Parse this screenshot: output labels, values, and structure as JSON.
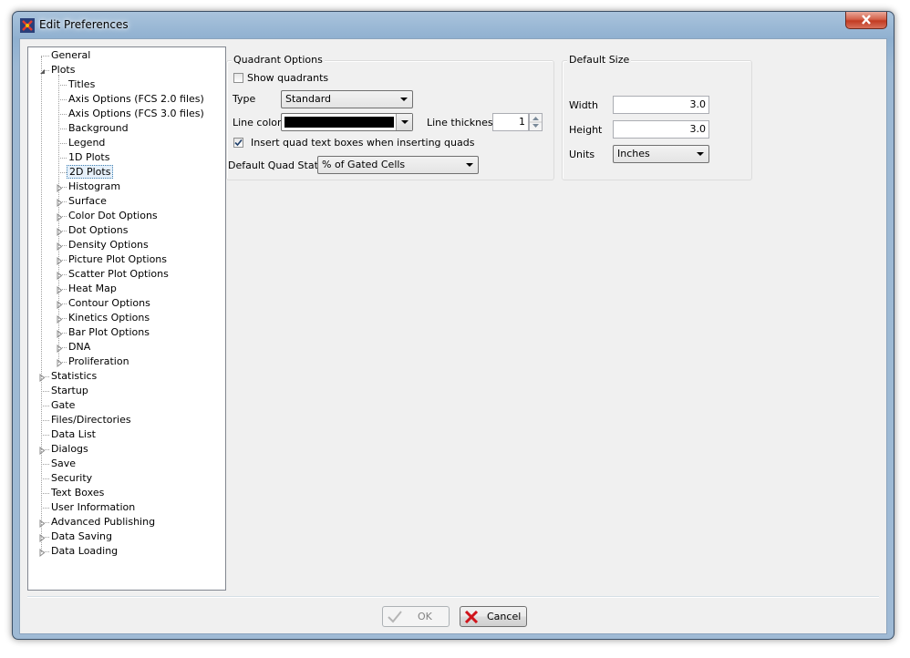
{
  "window": {
    "title": "Edit Preferences"
  },
  "tree": {
    "items": [
      {
        "label": "General",
        "level": 0,
        "expander": "none"
      },
      {
        "label": "Plots",
        "level": 0,
        "expander": "expanded"
      },
      {
        "label": "Titles",
        "level": 1,
        "expander": "none"
      },
      {
        "label": "Axis Options (FCS 2.0 files)",
        "level": 1,
        "expander": "none"
      },
      {
        "label": "Axis Options (FCS 3.0 files)",
        "level": 1,
        "expander": "none"
      },
      {
        "label": "Background",
        "level": 1,
        "expander": "none"
      },
      {
        "label": "Legend",
        "level": 1,
        "expander": "none"
      },
      {
        "label": "1D Plots",
        "level": 1,
        "expander": "none"
      },
      {
        "label": "2D Plots",
        "level": 1,
        "expander": "none",
        "selected": true
      },
      {
        "label": "Histogram",
        "level": 1,
        "expander": "collapsed"
      },
      {
        "label": "Surface",
        "level": 1,
        "expander": "collapsed"
      },
      {
        "label": "Color Dot Options",
        "level": 1,
        "expander": "collapsed"
      },
      {
        "label": "Dot Options",
        "level": 1,
        "expander": "collapsed"
      },
      {
        "label": "Density Options",
        "level": 1,
        "expander": "collapsed"
      },
      {
        "label": "Picture Plot Options",
        "level": 1,
        "expander": "collapsed"
      },
      {
        "label": "Scatter Plot Options",
        "level": 1,
        "expander": "collapsed"
      },
      {
        "label": "Heat Map",
        "level": 1,
        "expander": "collapsed"
      },
      {
        "label": "Contour Options",
        "level": 1,
        "expander": "collapsed"
      },
      {
        "label": "Kinetics Options",
        "level": 1,
        "expander": "collapsed"
      },
      {
        "label": "Bar Plot Options",
        "level": 1,
        "expander": "collapsed"
      },
      {
        "label": "DNA",
        "level": 1,
        "expander": "collapsed"
      },
      {
        "label": "Proliferation",
        "level": 1,
        "expander": "collapsed"
      },
      {
        "label": "Statistics",
        "level": 0,
        "expander": "collapsed"
      },
      {
        "label": "Startup",
        "level": 0,
        "expander": "none"
      },
      {
        "label": "Gate",
        "level": 0,
        "expander": "none"
      },
      {
        "label": "Files/Directories",
        "level": 0,
        "expander": "none"
      },
      {
        "label": "Data List",
        "level": 0,
        "expander": "none"
      },
      {
        "label": "Dialogs",
        "level": 0,
        "expander": "collapsed"
      },
      {
        "label": "Save",
        "level": 0,
        "expander": "none"
      },
      {
        "label": "Security",
        "level": 0,
        "expander": "none"
      },
      {
        "label": "Text Boxes",
        "level": 0,
        "expander": "none"
      },
      {
        "label": "User Information",
        "level": 0,
        "expander": "none"
      },
      {
        "label": "Advanced Publishing",
        "level": 0,
        "expander": "collapsed"
      },
      {
        "label": "Data Saving",
        "level": 0,
        "expander": "collapsed"
      },
      {
        "label": "Data Loading",
        "level": 0,
        "expander": "collapsed"
      }
    ]
  },
  "quadrant": {
    "group_title": "Quadrant Options",
    "show_quadrants_label": "Show quadrants",
    "show_quadrants_checked": false,
    "type_label": "Type",
    "type_value": "Standard",
    "line_color_label": "Line color",
    "line_color_value": "#000000",
    "line_thickness_label": "Line thickness",
    "line_thickness_value": "1",
    "insert_quad_label": "Insert quad text boxes when inserting quads",
    "insert_quad_checked": true,
    "default_quad_stat_label": "Default Quad Stat",
    "default_quad_stat_value": "% of Gated Cells"
  },
  "default_size": {
    "group_title": "Default Size",
    "width_label": "Width",
    "width_value": "3.0",
    "height_label": "Height",
    "height_value": "3.0",
    "units_label": "Units",
    "units_value": "Inches"
  },
  "buttons": {
    "ok_label": "OK",
    "cancel_label": "Cancel"
  }
}
